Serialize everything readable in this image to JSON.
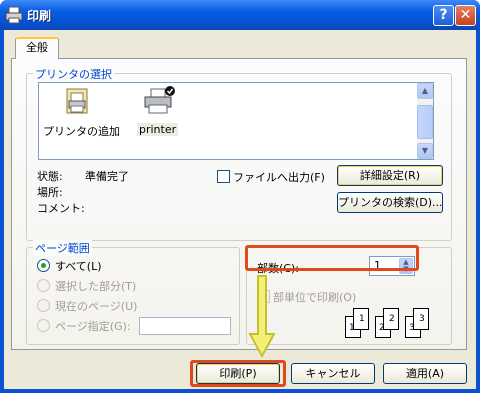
{
  "window": {
    "title": "印刷",
    "help_glyph": "?",
    "close_glyph": "✕"
  },
  "tabs": [
    {
      "label": "全般"
    }
  ],
  "printer_select": {
    "legend": "プリンタの選択",
    "items": [
      {
        "label": "プリンタの追加",
        "icon": "add-printer-icon"
      },
      {
        "label": "printer",
        "icon": "printer-icon",
        "selected": true,
        "default": true
      }
    ],
    "status_label": "状態:",
    "status_value": "準備完了",
    "location_label": "場所:",
    "comment_label": "コメント:",
    "print_to_file_label": "ファイルへ出力(F)",
    "print_to_file_checked": false,
    "preferences_button": "詳細設定(R)",
    "find_printer_button": "プリンタの検索(D)..."
  },
  "page_range": {
    "legend": "ページ範囲",
    "options": [
      {
        "label": "すべて(L)",
        "selected": true,
        "enabled": true
      },
      {
        "label": "選択した部分(T)",
        "selected": false,
        "enabled": false
      },
      {
        "label": "現在のページ(U)",
        "selected": false,
        "enabled": false
      },
      {
        "label": "ページ指定(G):",
        "selected": false,
        "enabled": false
      }
    ],
    "pages_value": ""
  },
  "copies": {
    "label": "部数(C):",
    "value": "1",
    "collate_label": "部単位で印刷(O)",
    "collate_checked": false,
    "collate_pages": [
      "1",
      "1",
      "2",
      "2",
      "3",
      "3"
    ]
  },
  "buttons": {
    "print": "印刷(P)",
    "cancel": "キャンセル",
    "apply": "適用(A)"
  },
  "colors": {
    "titlebar": "#0a5fe4",
    "dialog": "#ece9d8",
    "highlight_box": "#e04a1a",
    "arrow": "#f3f07a",
    "legend_text": "#0046d5"
  }
}
